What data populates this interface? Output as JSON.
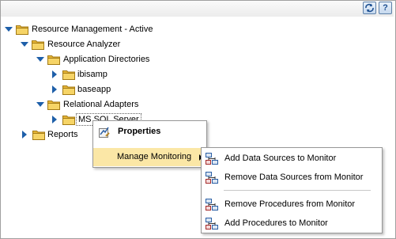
{
  "toolbar": {
    "refresh_icon": "refresh-icon",
    "help_icon": "help-icon",
    "help_label": "?"
  },
  "tree": {
    "root": "Resource Management - Active",
    "resource_analyzer": "Resource Analyzer",
    "application_directories": "Application Directories",
    "ibisamp": "ibisamp",
    "baseapp": "baseapp",
    "relational_adapters": "Relational Adapters",
    "ms_sql_server": "MS SQL Server",
    "reports": "Reports"
  },
  "context_menu": {
    "properties": "Properties",
    "manage_monitoring": "Manage Monitoring"
  },
  "submenu": {
    "add_data_sources": "Add Data Sources to Monitor",
    "remove_data_sources": "Remove Data Sources from Monitor",
    "remove_procedures": "Remove Procedures from Monitor",
    "add_procedures": "Add Procedures to Monitor"
  },
  "colors": {
    "folder": "#f2c752",
    "highlight": "#fbe7a6",
    "twisty": "#1e5fa9"
  }
}
